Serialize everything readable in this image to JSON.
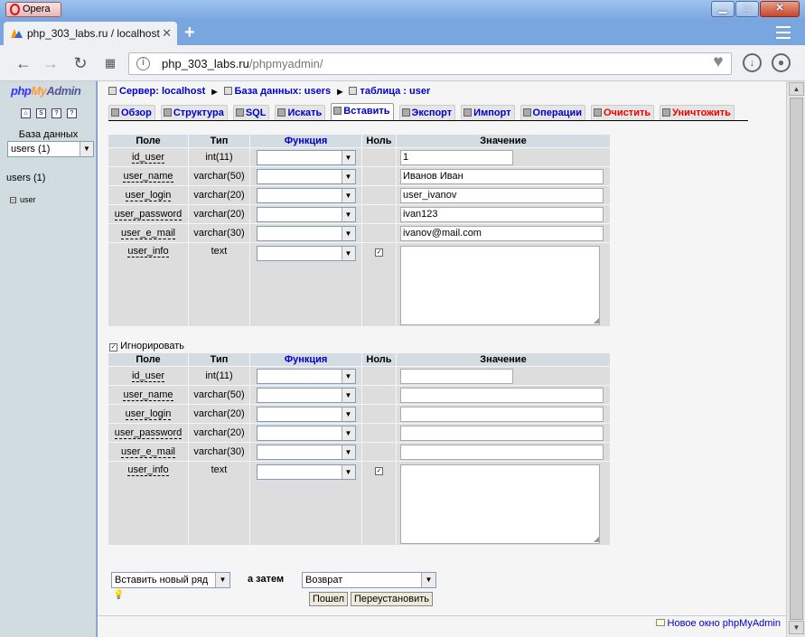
{
  "browser": {
    "app_name": "Opera",
    "tab_title": "php_303_labs.ru / localhost",
    "address_host": "php_303_labs.ru",
    "address_path": "/phpmyadmin/"
  },
  "left": {
    "logo_php": "php",
    "logo_my": "My",
    "logo_admin": "Admin",
    "db_label": "База данных",
    "db_select_value": "users (1)",
    "db_group": "users (1)",
    "table_item": "user"
  },
  "breadcrumb": {
    "server": "Сервер: localhost",
    "database": "База данных: users",
    "table": "таблица : user"
  },
  "tabs": [
    {
      "label": "Обзор"
    },
    {
      "label": "Структура"
    },
    {
      "label": "SQL"
    },
    {
      "label": "Искать"
    },
    {
      "label": "Вставить"
    },
    {
      "label": "Экспорт"
    },
    {
      "label": "Импорт"
    },
    {
      "label": "Операции"
    },
    {
      "label": "Очистить"
    },
    {
      "label": "Уничтожить"
    }
  ],
  "table_headers": {
    "field": "Поле",
    "type": "Тип",
    "function": "Функция",
    "null": "Ноль",
    "value": "Значение"
  },
  "form1": {
    "rows": [
      {
        "field": "id_user",
        "type": "int(11)",
        "value": "1"
      },
      {
        "field": "user_name",
        "type": "varchar(50)",
        "value": "Иванов Иван"
      },
      {
        "field": "user_login",
        "type": "varchar(20)",
        "value": "user_ivanov"
      },
      {
        "field": "user_password",
        "type": "varchar(20)",
        "value": "ivan123"
      },
      {
        "field": "user_e_mail",
        "type": "varchar(30)",
        "value": "ivanov@mail.com"
      },
      {
        "field": "user_info",
        "type": "text",
        "value": ""
      }
    ]
  },
  "ignore_label": "Игнорировать",
  "form2": {
    "rows": [
      {
        "field": "id_user",
        "type": "int(11)",
        "value": ""
      },
      {
        "field": "user_name",
        "type": "varchar(50)",
        "value": ""
      },
      {
        "field": "user_login",
        "type": "varchar(20)",
        "value": ""
      },
      {
        "field": "user_password",
        "type": "varchar(20)",
        "value": ""
      },
      {
        "field": "user_e_mail",
        "type": "varchar(30)",
        "value": ""
      },
      {
        "field": "user_info",
        "type": "text",
        "value": ""
      }
    ]
  },
  "bottom": {
    "insert_mode": "Вставить новый ряд",
    "then_label": "а затем",
    "after_action": "Возврат",
    "go_button": "Пошел",
    "reset_button": "Переустановить",
    "new_window_link": "Новое окно phpMyAdmin"
  }
}
